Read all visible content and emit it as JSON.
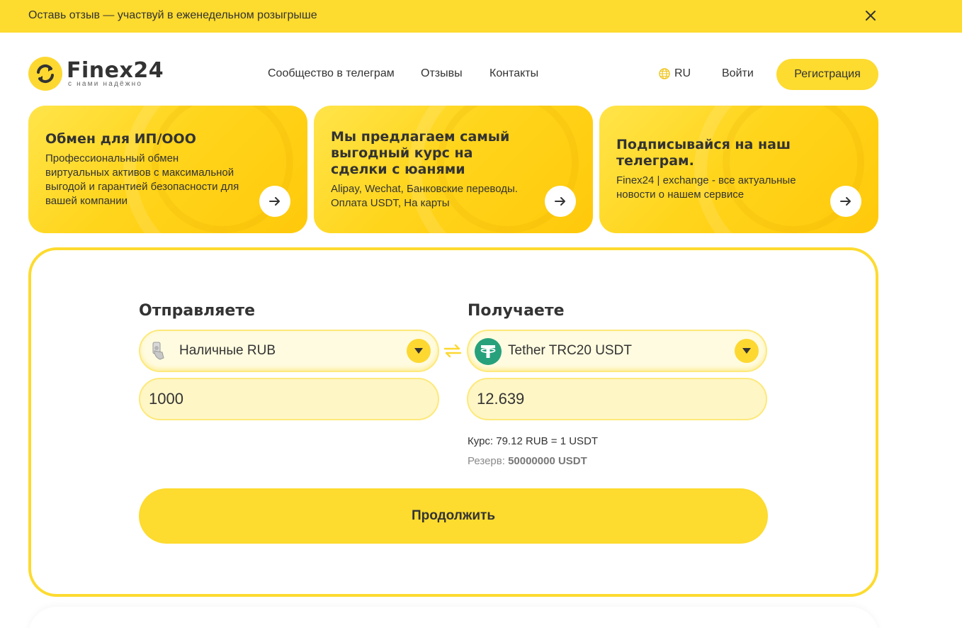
{
  "banner": {
    "text": "Оставь отзыв — участвуй в еженедельном розыгрыше"
  },
  "logo": {
    "name": "Finex24",
    "tagline": "с нами надёжно"
  },
  "nav": {
    "community": "Сообщество в телеграм",
    "reviews": "Отзывы",
    "contacts": "Контакты"
  },
  "header": {
    "lang": "RU",
    "login": "Войти",
    "register": "Регистрация"
  },
  "cards": [
    {
      "title": "Обмен для ИП/ООО",
      "text": "Профессиональный обмен виртуальных активов с максимальной выгодой и гарантией безопасности для вашей компании"
    },
    {
      "title": "Мы предлагаем самый выгодный курс на сделки с юанями",
      "text": "Alipay, Wechat, Банковские переводы. Оплата USDT, На карты"
    },
    {
      "title": "Подписывайся на наш телеграм.",
      "text": "Finex24 | exchange - все актуальные новости о нашем сервисе"
    }
  ],
  "exchange": {
    "send": {
      "title": "Отправляете",
      "currency": "Наличные RUB",
      "amount": "1000"
    },
    "receive": {
      "title": "Получаете",
      "currency": "Tether TRC20 USDT",
      "amount": "12.639"
    },
    "rate": "Курс: 79.12 RUB = 1 USDT",
    "reserve_label": "Резерв:",
    "reserve_value": "50000000 USDT",
    "continue": "Продолжить"
  },
  "colors": {
    "accent": "#fddb2f",
    "tether": "#26a17b",
    "text": "#333333"
  }
}
